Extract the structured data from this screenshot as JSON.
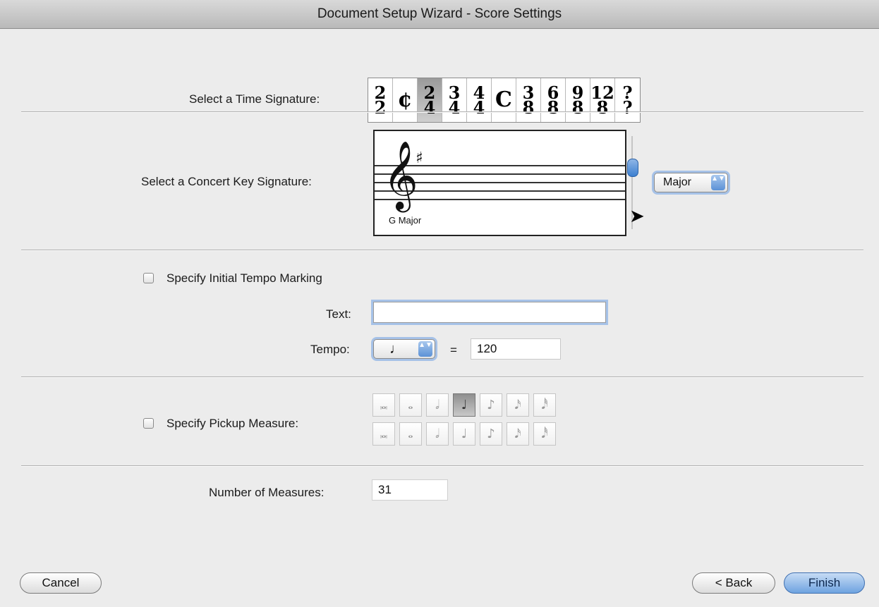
{
  "window": {
    "title": "Document Setup Wizard - Score Settings"
  },
  "time_signature": {
    "label": "Select a Time Signature:",
    "options": [
      {
        "type": "fraction",
        "top": "2",
        "bottom": "2"
      },
      {
        "type": "symbol",
        "glyph": "¢"
      },
      {
        "type": "fraction",
        "top": "2",
        "bottom": "4",
        "selected": true
      },
      {
        "type": "fraction",
        "top": "3",
        "bottom": "4"
      },
      {
        "type": "fraction",
        "top": "4",
        "bottom": "4"
      },
      {
        "type": "symbol",
        "glyph": "C"
      },
      {
        "type": "fraction",
        "top": "3",
        "bottom": "8"
      },
      {
        "type": "fraction",
        "top": "6",
        "bottom": "8"
      },
      {
        "type": "fraction",
        "top": "9",
        "bottom": "8"
      },
      {
        "type": "fraction",
        "top": "12",
        "bottom": "8"
      },
      {
        "type": "fraction",
        "top": "?",
        "bottom": "?"
      }
    ]
  },
  "key_signature": {
    "label": "Select a Concert Key Signature:",
    "key_name": "G Major",
    "clef_glyph": "𝄞",
    "sharp_glyph": "♯",
    "mode_select": "Major"
  },
  "tempo": {
    "checkbox_label": "Specify Initial Tempo Marking",
    "text_label": "Text:",
    "text_value": "",
    "tempo_label": "Tempo:",
    "note_glyph": "♩",
    "equals": "=",
    "tempo_value": "120"
  },
  "pickup": {
    "checkbox_label": "Specify Pickup Measure:",
    "row1": [
      "𝅜",
      "𝅝",
      "𝅗𝅥",
      "♩",
      "♪",
      "𝅘𝅥𝅯",
      "𝅘𝅥𝅰"
    ],
    "row2": [
      "𝅜",
      "𝅝",
      "𝅗𝅥",
      "♩",
      "♪",
      "𝅘𝅥𝅯",
      "𝅘𝅥𝅰"
    ],
    "selected_index": 3
  },
  "measures": {
    "label": "Number of Measures:",
    "value": "31"
  },
  "buttons": {
    "cancel": "Cancel",
    "back": "< Back",
    "finish": "Finish"
  },
  "stepper_glyph": "▲▼"
}
